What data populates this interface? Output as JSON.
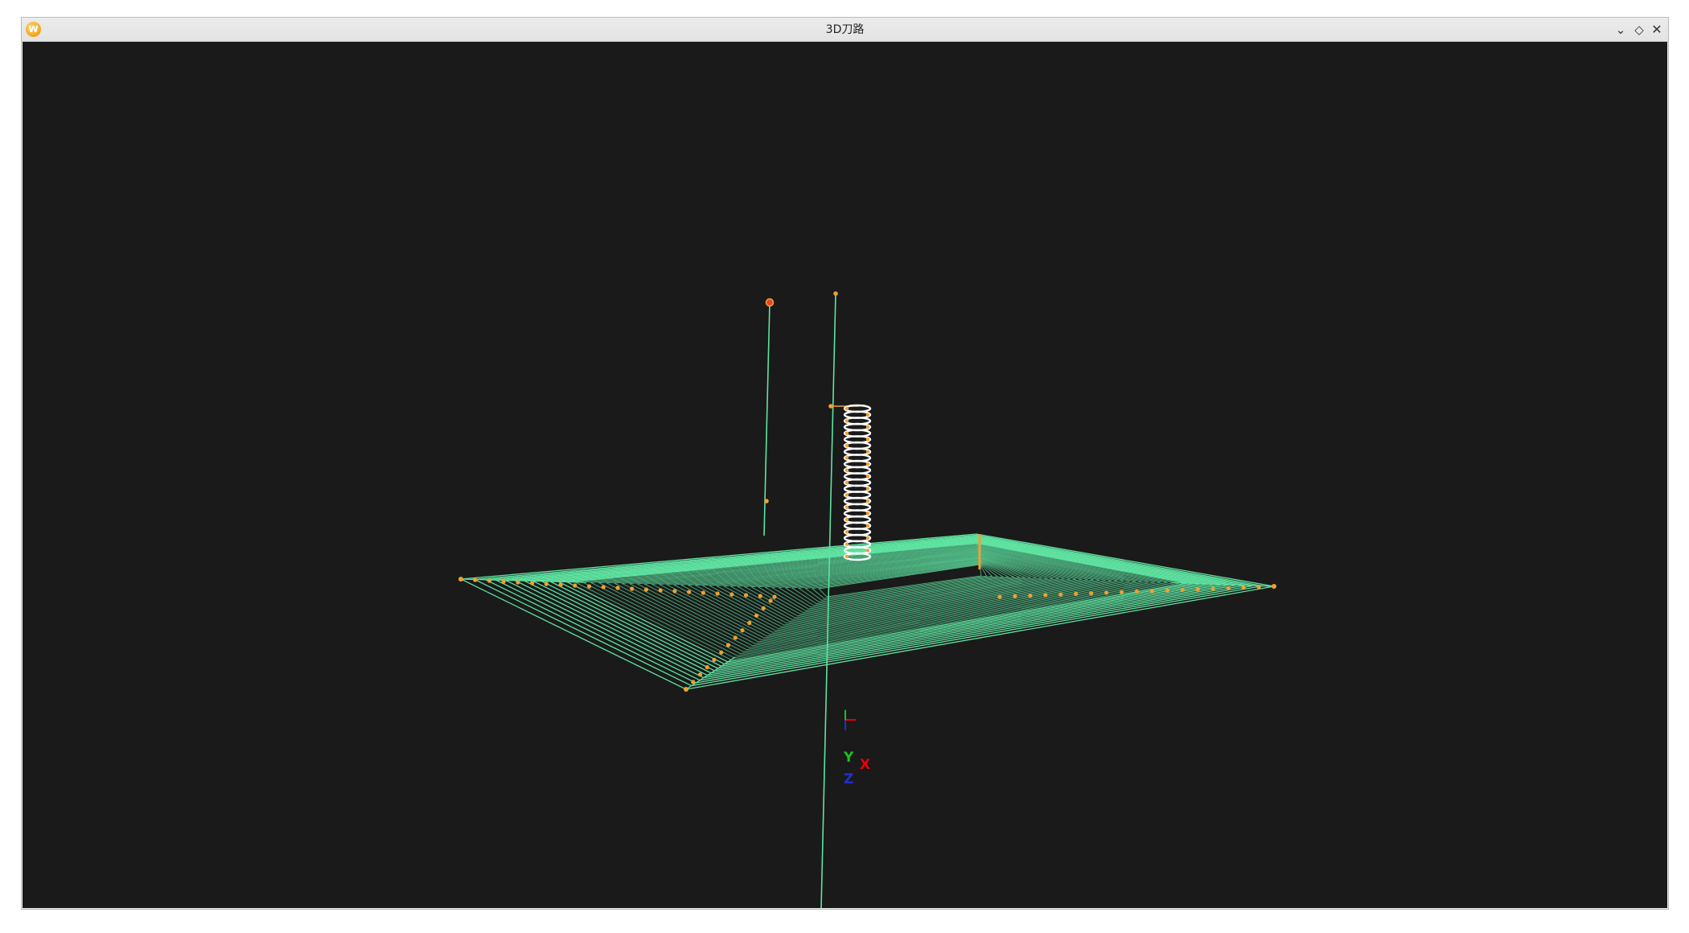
{
  "window": {
    "title": "3D刀路",
    "app_icon": "wps-app-icon",
    "controls": {
      "minimize": "⌄",
      "restore": "◇",
      "close": "✕"
    }
  },
  "viewport": {
    "background": "#1a1a1a",
    "toolpath_color": "#5fe3a1",
    "point_color": "#f0a030",
    "start_point_color": "#e8452c",
    "helix_color": "#ffffff"
  },
  "axis_indicator": {
    "labels": {
      "x": "X",
      "y": "Y",
      "z": "Z"
    },
    "colors": {
      "x": "#e8000b",
      "y": "#1fbf1f",
      "z": "#2030d0"
    }
  }
}
